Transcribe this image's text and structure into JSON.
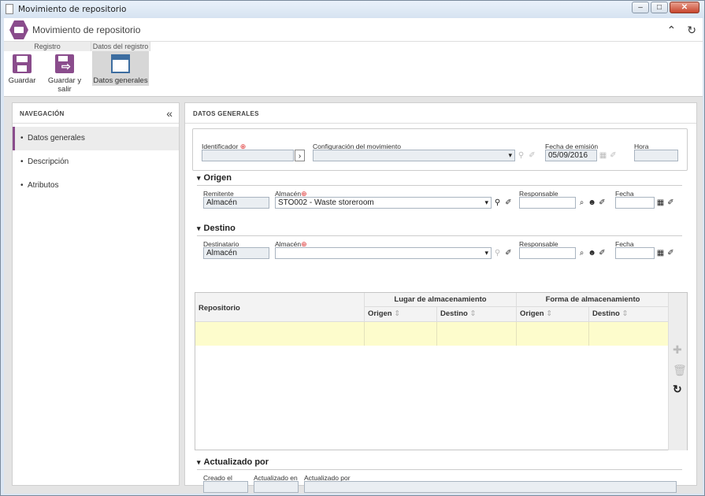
{
  "window": {
    "title": "Movimiento de repositorio",
    "minimize": "–",
    "maximize": "□",
    "close": "✕"
  },
  "app": {
    "title": "Movimiento de repositorio",
    "collapse_icon": "⌃",
    "refresh_icon": "↻"
  },
  "ribbon": {
    "groups": [
      "Registro",
      "Datos del registro"
    ],
    "buttons": {
      "save": "Guardar",
      "save_exit": "Guardar y salir",
      "general": "Datos generales"
    }
  },
  "nav": {
    "header": "NAVEGACIÓN",
    "collapse_icon": "«",
    "items": [
      "Datos generales",
      "Descripción",
      "Atributos"
    ],
    "active_index": 0
  },
  "main": {
    "header": "DATOS GENERALES",
    "top": {
      "identificador_label": "Identificador",
      "identificador_value": "",
      "config_label": "Configuración del movimiento",
      "config_value": "",
      "fecha_label": "Fecha de emisión",
      "fecha_value": "05/09/2016",
      "hora_label": "Hora",
      "hora_value": ""
    },
    "origen": {
      "title": "Origen",
      "remitente_label": "Remitente",
      "remitente_value": "Almacén",
      "almacen_label": "Almacén",
      "almacen_value": "STO002 - Waste storeroom",
      "responsable_label": "Responsable",
      "responsable_value": "",
      "fecha_label": "Fecha",
      "fecha_value": ""
    },
    "destino": {
      "title": "Destino",
      "destinatario_label": "Destinatario",
      "destinatario_value": "Almacén",
      "almacen_label": "Almacén",
      "almacen_value": "",
      "responsable_label": "Responsable",
      "responsable_value": "",
      "fecha_label": "Fecha",
      "fecha_value": ""
    },
    "grid": {
      "col_repositorio": "Repositorio",
      "group_lugar": "Lugar de almacenamiento",
      "group_forma": "Forma de almacenamiento",
      "sub_origen": "Origen",
      "sub_destino": "Destino",
      "sort_icon": "⇕"
    },
    "actualizado": {
      "title": "Actualizado por",
      "creado_label": "Creado el",
      "creado_value": "",
      "actualizado_en_label": "Actualizado en",
      "actualizado_en_value": "",
      "actualizado_por_label": "Actualizado por",
      "actualizado_por_value": ""
    }
  }
}
